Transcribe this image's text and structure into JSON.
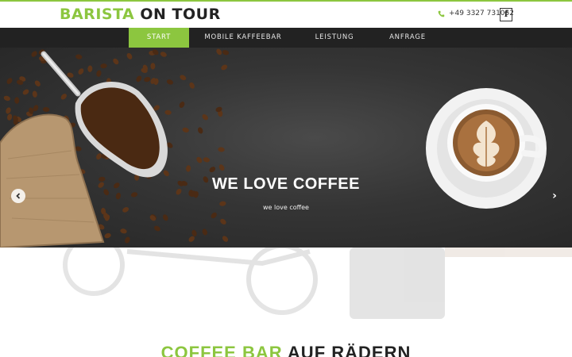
{
  "brand": {
    "part1": "BARISTA",
    "part2": "ON TOUR"
  },
  "contact": {
    "phone": "+49 3327 731052",
    "social_icon": "facebook-icon",
    "social_glyph": "f"
  },
  "nav": {
    "items": [
      {
        "label": "START",
        "active": true
      },
      {
        "label": "MOBILE KAFFEEBAR",
        "active": false
      },
      {
        "label": "LEISTUNG",
        "active": false
      },
      {
        "label": "ANFRAGE",
        "active": false
      }
    ]
  },
  "hero": {
    "title": "WE LOVE COFFEE",
    "subtitle": "we love coffee",
    "prev_icon": "chevron-left-icon",
    "next_icon": "chevron-right-icon",
    "next_glyph": "›"
  },
  "section": {
    "title_part1": "COFFEE BAR",
    "title_part2": "AUF RÄDERN"
  },
  "colors": {
    "accent": "#8cc63f",
    "nav_bg": "#222222",
    "text_dark": "#222222"
  }
}
